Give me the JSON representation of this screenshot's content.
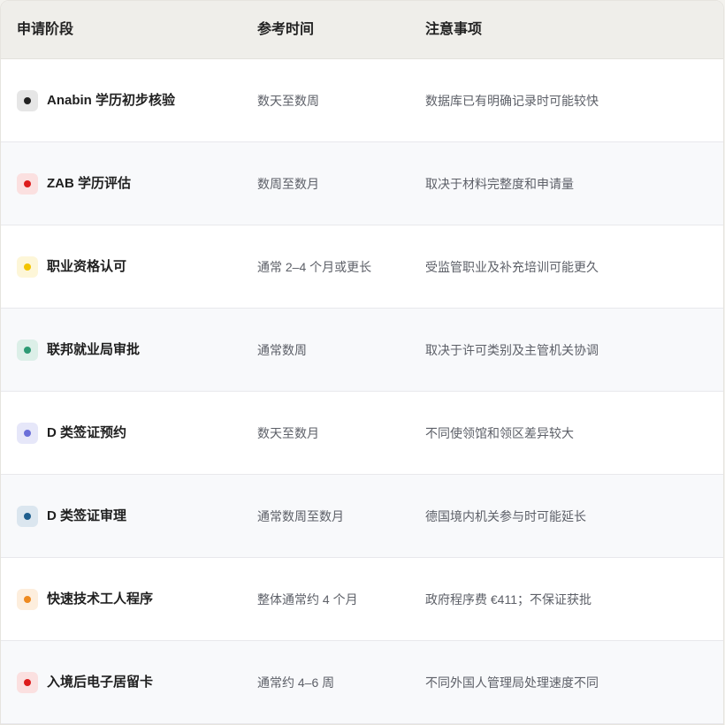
{
  "headers": {
    "stage": "申请阶段",
    "time": "参考时间",
    "notes": "注意事项"
  },
  "rows": [
    {
      "stage": "Anabin 学历初步核验",
      "time": "数天至数周",
      "note": "数据库已有明确记录时可能较快",
      "dot_color": "#222222",
      "badge_bg": "#e6e6e6"
    },
    {
      "stage": "ZAB 学历评估",
      "time": "数周至数月",
      "note": "取决于材料完整度和申请量",
      "dot_color": "#dd1c1c",
      "badge_bg": "#fbe0e0"
    },
    {
      "stage": "职业资格认可",
      "time": "通常 2–4 个月或更长",
      "note": "受监管职业及补充培训可能更久",
      "dot_color": "#f2c400",
      "badge_bg": "#fdf6d8"
    },
    {
      "stage": "联邦就业局审批",
      "time": "通常数周",
      "note": "取决于许可类别及主管机关协调",
      "dot_color": "#2d9a74",
      "badge_bg": "#dcefe8"
    },
    {
      "stage": "D 类签证预约",
      "time": "数天至数月",
      "note": "不同使领馆和领区差异较大",
      "dot_color": "#6b6fd9",
      "badge_bg": "#e6e7f9"
    },
    {
      "stage": "D 类签证审理",
      "time": "通常数周至数月",
      "note": "德国境内机关参与时可能延长",
      "dot_color": "#1f5f8e",
      "badge_bg": "#dbe6ef"
    },
    {
      "stage": "快速技术工人程序",
      "time": "整体通常约 4 个月",
      "note": "政府程序费 €411；不保证获批",
      "dot_color": "#ee8a1f",
      "badge_bg": "#fdeedd"
    },
    {
      "stage": "入境后电子居留卡",
      "time": "通常约 4–6 周",
      "note": "不同外国人管理局处理速度不同",
      "dot_color": "#dd1c1c",
      "badge_bg": "#fbe0e0"
    }
  ]
}
